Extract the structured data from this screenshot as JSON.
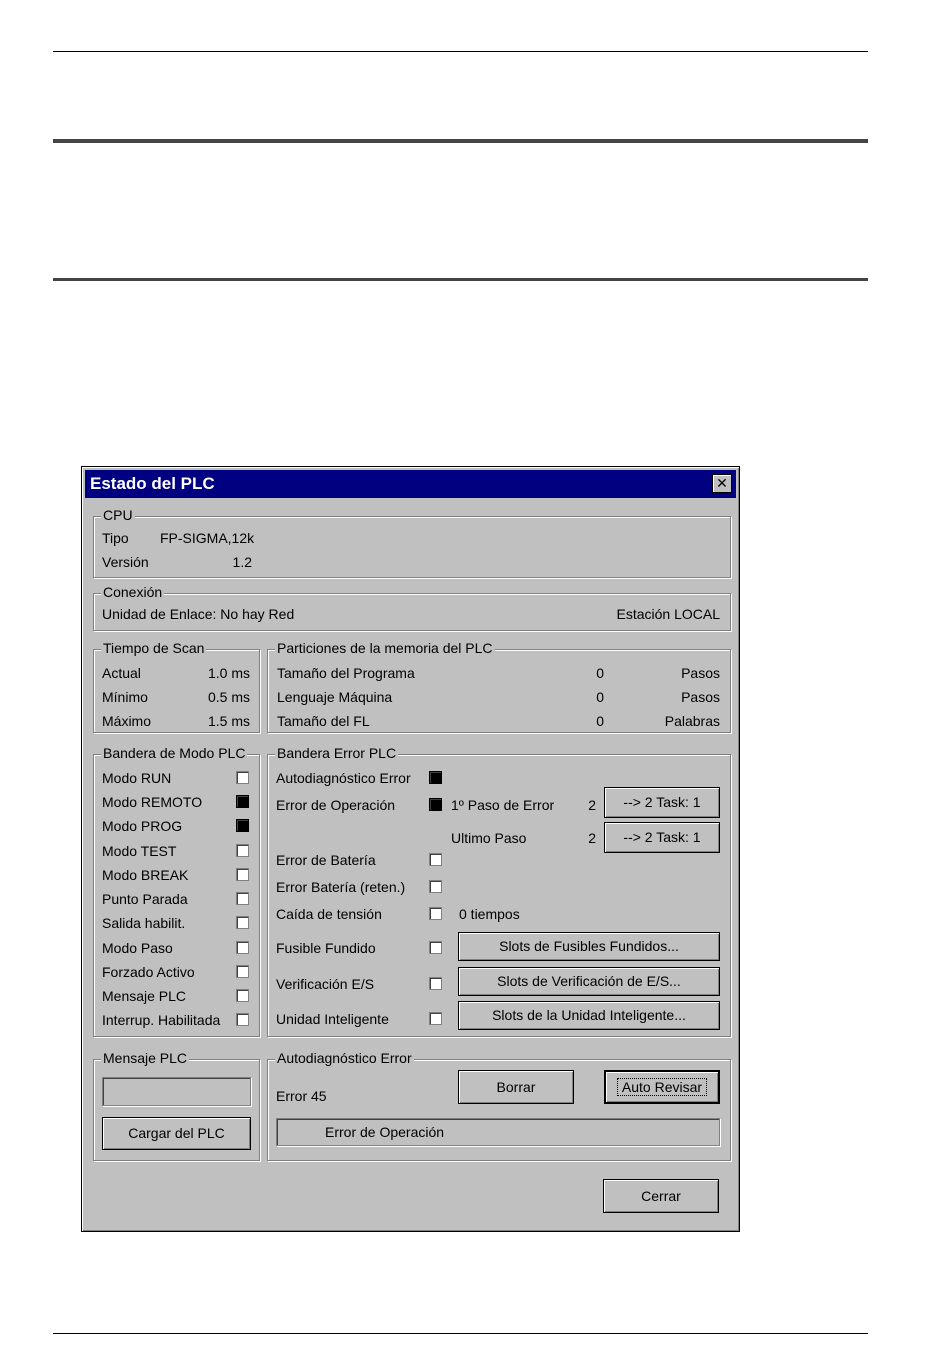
{
  "window": {
    "title": "Estado del PLC",
    "close_glyph": "✕"
  },
  "cpu": {
    "legend": "CPU",
    "tipo_label": "Tipo",
    "tipo_value": "FP-SIGMA,12k",
    "version_label": "Versión",
    "version_value": "1.2"
  },
  "conexion": {
    "legend": "Conexión",
    "unidad": "Unidad de Enlace: No hay Red",
    "estacion": "Estación LOCAL"
  },
  "scan": {
    "legend": "Tiempo de Scan",
    "rows": [
      {
        "label": "Actual",
        "value": "1.0 ms"
      },
      {
        "label": "Mínimo",
        "value": "0.5 ms"
      },
      {
        "label": "Máximo",
        "value": "1.5 ms"
      }
    ]
  },
  "particiones": {
    "legend": "Particiones de la memoria del PLC",
    "rows": [
      {
        "label": "Tamaño del Programa",
        "value": "0",
        "unit": "Pasos"
      },
      {
        "label": "Lenguaje Máquina",
        "value": "0",
        "unit": "Pasos"
      },
      {
        "label": "Tamaño del FL",
        "value": "0",
        "unit": "Palabras"
      }
    ]
  },
  "modo": {
    "legend": "Bandera de Modo PLC",
    "items": [
      {
        "label": "Modo RUN",
        "checked": false
      },
      {
        "label": "Modo REMOTO",
        "checked": true
      },
      {
        "label": "Modo PROG",
        "checked": true
      },
      {
        "label": "Modo TEST",
        "checked": false
      },
      {
        "label": "Modo BREAK",
        "checked": false
      },
      {
        "label": "Punto  Parada",
        "checked": false
      },
      {
        "label": "Salida habilit.",
        "checked": false
      },
      {
        "label": "Modo Paso",
        "checked": false
      },
      {
        "label": "Forzado Activo",
        "checked": false
      },
      {
        "label": "Mensaje PLC",
        "checked": false
      },
      {
        "label": "Interrup. Habilitada",
        "checked": false
      }
    ]
  },
  "error_flags": {
    "legend": "Bandera Error PLC",
    "items": [
      {
        "label": "Autodiagnóstico Error",
        "checked": true
      },
      {
        "label": "Error de Operación",
        "checked": true
      },
      {
        "label": "Error de Batería",
        "checked": false
      },
      {
        "label": "Error Batería (reten.)",
        "checked": false
      },
      {
        "label": "Caída de tensión",
        "checked": false
      },
      {
        "label": "Fusible Fundido",
        "checked": false
      },
      {
        "label": "Verificación E/S",
        "checked": false
      },
      {
        "label": "Unidad Inteligente",
        "checked": false
      }
    ],
    "first_step_label": "1º Paso de Error",
    "first_step_value": "2",
    "first_step_button": "--> 2 Task: 1",
    "last_step_label": "Ultimo Paso",
    "last_step_value": "2",
    "last_step_button": "--> 2 Task: 1",
    "caida_count": "0 tiempos",
    "fusibles_button": "Slots de Fusibles Fundidos...",
    "verificacion_button": "Slots de Verificación de E/S...",
    "unidad_button": "Slots de la Unidad Inteligente..."
  },
  "mensaje": {
    "legend": "Mensaje PLC",
    "value": "",
    "cargar_button": "Cargar del PLC"
  },
  "autodiag": {
    "legend": "Autodiagnóstico Error",
    "error_code": "Error 45",
    "borrar_button": "Borrar",
    "auto_revisar_button": "Auto Revisar",
    "message": "Error de Operación"
  },
  "footer": {
    "cerrar_button": "Cerrar"
  }
}
